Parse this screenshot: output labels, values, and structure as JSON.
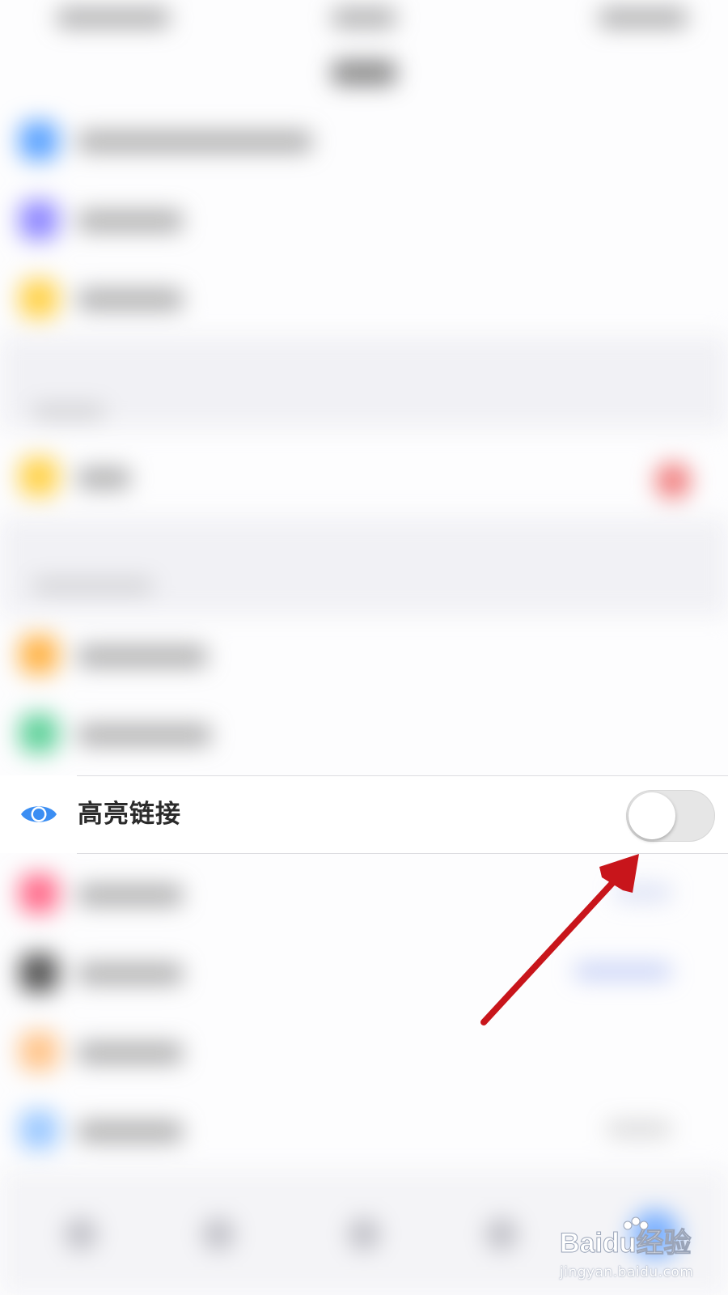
{
  "row": {
    "label": "高亮链接",
    "toggle_on": false
  },
  "watermark": {
    "brand": "Baidu经验",
    "url": "jingyan.baidu.com"
  },
  "colors": {
    "eye_icon": "#3b8ef3",
    "arrow": "#c8151b",
    "toggle_off": "#e6e6e6"
  },
  "icons": {
    "row_icon": "eye-icon",
    "watermark_icon": "paw-icon"
  }
}
